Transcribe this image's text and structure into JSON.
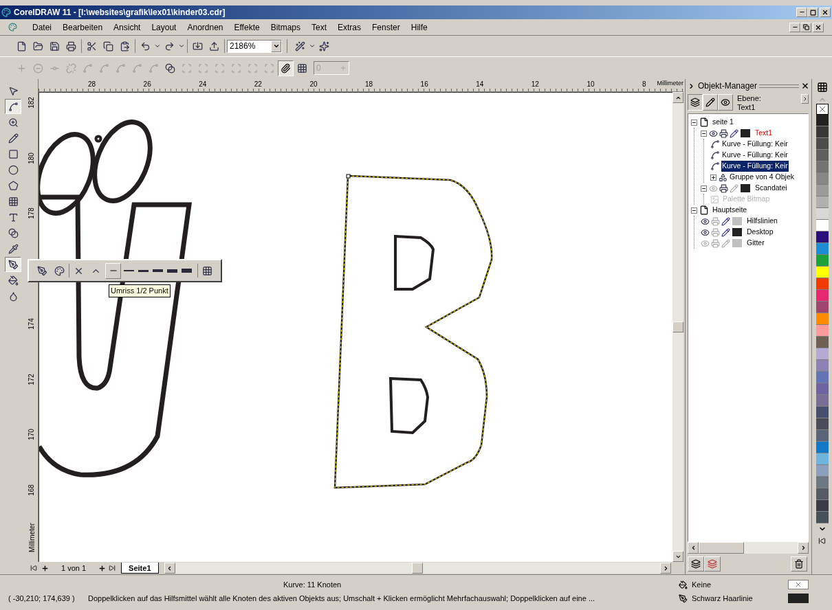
{
  "window": {
    "title": "CorelDRAW 11 - [I:\\websites\\grafik\\lex01\\kinder03.cdr]"
  },
  "menu": [
    {
      "label": "Datei"
    },
    {
      "label": "Bearbeiten"
    },
    {
      "label": "Ansicht"
    },
    {
      "label": "Layout"
    },
    {
      "label": "Anordnen"
    },
    {
      "label": "Effekte"
    },
    {
      "label": "Bitmaps"
    },
    {
      "label": "Text"
    },
    {
      "label": "Extras"
    },
    {
      "label": "Fenster"
    },
    {
      "label": "Hilfe"
    }
  ],
  "toolbar": {
    "zoom": "2186%"
  },
  "property_bar": {
    "node_field": {
      "value": "0",
      "disabled": true
    }
  },
  "toolbox": [
    {
      "selected": false
    },
    {
      "selected": true
    },
    {
      "selected": false
    },
    {
      "selected": false
    },
    {
      "selected": false
    },
    {
      "selected": false
    },
    {
      "selected": false
    },
    {
      "selected": false
    },
    {
      "selected": false
    },
    {
      "selected": false
    },
    {
      "selected": false
    },
    {
      "selected": true
    },
    {
      "selected": false
    },
    {
      "selected": false
    }
  ],
  "flyout": {
    "tooltip": "Umriss 1/2 Punkt"
  },
  "rulers": {
    "horizontal": [
      "28",
      "26",
      "24",
      "22",
      "20",
      "18",
      "16",
      "14",
      "12",
      "10",
      "8"
    ],
    "horizontal_unit": "Millimeter",
    "vertical_upper": [
      "182",
      "180",
      "178"
    ],
    "vertical_lower": [
      "174",
      "172",
      "170",
      "168"
    ],
    "vertical_unit": "Millimeter"
  },
  "page_nav": {
    "position": "1 von 1",
    "tabs": [
      {
        "label": "Seite1",
        "selected": true
      }
    ]
  },
  "docker": {
    "title": "Objekt-Manager",
    "layer_caption": "Ebene:",
    "layer_name": "Text1",
    "tree": [
      {
        "kind": "page",
        "label": "seite 1",
        "expanded": true,
        "selected": false,
        "children": [
          {
            "kind": "layer",
            "label": "Text1",
            "expanded": true,
            "selected": false,
            "active": true,
            "visible": true,
            "printable": true,
            "editable": true,
            "color": "#222222",
            "children": [
              {
                "kind": "curve",
                "label": "Kurve - Füllung: Keir",
                "selected": false
              },
              {
                "kind": "curve",
                "label": "Kurve - Füllung: Keir",
                "selected": false
              },
              {
                "kind": "curve",
                "label": "Kurve - Füllung: Keir",
                "selected": true
              },
              {
                "kind": "group",
                "label": "Gruppe von 4 Objek",
                "expanded": false,
                "selected": false
              }
            ]
          },
          {
            "kind": "layer",
            "label": "Scandatei",
            "expanded": true,
            "selected": false,
            "active": false,
            "visible": false,
            "printable": true,
            "editable": false,
            "color": "#222222",
            "children": [
              {
                "kind": "bitmap",
                "label": "Palette Bitmap",
                "selected": false,
                "disabled": true
              }
            ]
          }
        ]
      },
      {
        "kind": "page",
        "label": "Hauptseite",
        "expanded": true,
        "selected": false,
        "children": [
          {
            "kind": "layer",
            "label": "Hilfslinien",
            "selected": false,
            "active": false,
            "visible": true,
            "printable": false,
            "editable": true,
            "color": "#c0c0c0"
          },
          {
            "kind": "layer",
            "label": "Desktop",
            "selected": false,
            "active": false,
            "visible": true,
            "printable": false,
            "editable": true,
            "color": "#222222"
          },
          {
            "kind": "layer",
            "label": "Gitter",
            "selected": false,
            "active": false,
            "visible": false,
            "printable": false,
            "editable": false,
            "color": "#c0c0c0"
          }
        ]
      }
    ]
  },
  "palette": [
    {
      "color": "#222222"
    },
    {
      "color": "#383838"
    },
    {
      "color": "#4c4c4c"
    },
    {
      "color": "#5f5f5f"
    },
    {
      "color": "#737373"
    },
    {
      "color": "#878787"
    },
    {
      "color": "#9b9b9b"
    },
    {
      "color": "#b0b0b0"
    },
    {
      "color": "#d8d8d8"
    },
    {
      "color": "#ffffff"
    },
    {
      "color": "#2a0f7a"
    },
    {
      "color": "#1e8cd2"
    },
    {
      "color": "#1ea03c"
    },
    {
      "color": "#ffff00"
    },
    {
      "color": "#f03c00"
    },
    {
      "color": "#e6286e"
    },
    {
      "color": "#a0466e"
    },
    {
      "color": "#ff8c00"
    },
    {
      "color": "#ff9b9b"
    },
    {
      "color": "#6e5f55"
    },
    {
      "color": "#b4aad2"
    },
    {
      "color": "#8c82b4"
    },
    {
      "color": "#6473b4"
    },
    {
      "color": "#6e64a0"
    },
    {
      "color": "#786e96"
    },
    {
      "color": "#46506e"
    },
    {
      "color": "#4b4b5a"
    },
    {
      "color": "#5a6478"
    },
    {
      "color": "#1478c8"
    },
    {
      "color": "#6eb4dc"
    },
    {
      "color": "#8ca0be"
    },
    {
      "color": "#6e7882"
    },
    {
      "color": "#555a64"
    },
    {
      "color": "#3c3c46"
    },
    {
      "color": "#465058"
    }
  ],
  "status_bar": {
    "object_info": "Kurve: 11 Knoten",
    "coordinates": "( -30,210; 174,639 )",
    "hint": "Doppelklicken auf das Hilfsmittel wählt alle Knoten des aktiven Objekts aus; Umschalt + Klicken ermöglicht Mehrfachauswahl; Doppelklicken auf eine ...",
    "fill": "Keine",
    "outline": "Schwarz Haarlinie"
  }
}
